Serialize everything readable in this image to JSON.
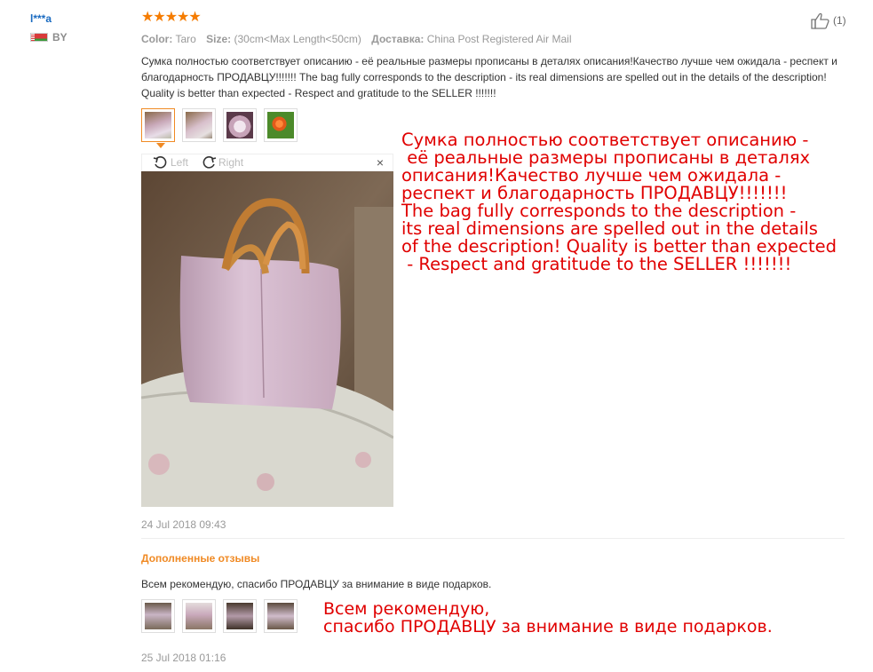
{
  "user": {
    "name": "l***a",
    "country": "BY"
  },
  "rating": {
    "stars": "★★★★★"
  },
  "helpful": {
    "count": "(1)"
  },
  "meta": {
    "color_label": "Color:",
    "color_value": "Taro",
    "size_label": "Size:",
    "size_value": "(30cm<Max Length<50cm)",
    "delivery_label": "Доставка:",
    "delivery_value": "China Post Registered Air Mail"
  },
  "review_text": "Сумка полностью соответствует описанию - её реальные размеры прописаны в деталях описания!Качество лучше чем ожидала - респект и благодарность ПРОДАВЦУ!!!!!!! The bag fully corresponds to the description - its real dimensions are spelled out in the details of the description! Quality is better than expected - Respect and gratitude to the SELLER !!!!!!!",
  "viewer": {
    "left_label": "Left",
    "right_label": "Right",
    "close": "×"
  },
  "date1": "24 Jul 2018 09:43",
  "additional": {
    "title": "Дополненные отзывы",
    "text": "Всем рекомендую, спасибо ПРОДАВЦУ за внимание в виде подарков.",
    "date": "25 Jul 2018 01:16"
  },
  "overlay_text_1": "Сумка полностью соответствует описанию -\n её реальные размеры прописаны в деталях\nописания!Качество лучше чем ожидала -\nреспект и благодарность ПРОДАВЦУ!!!!!!!\nThe bag fully corresponds to the description -\nits real dimensions are spelled out in the details\nof the description! Quality is better than expected\n - Respect and gratitude to the SELLER !!!!!!!",
  "overlay_text_2": "Всем рекомендую,\nспасибо ПРОДАВЦУ за внимание в виде подарков.",
  "colors": {
    "star": "#f57c00",
    "accent": "#f08a24",
    "link": "#1a6bc1",
    "overlay_red": "#e00000"
  }
}
